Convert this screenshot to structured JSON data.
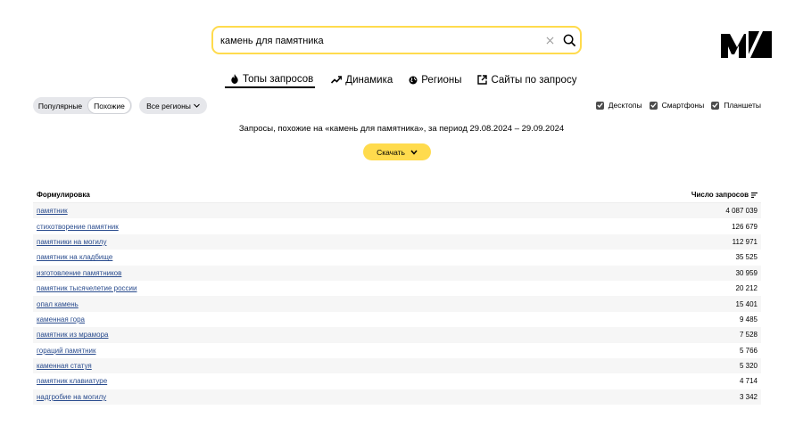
{
  "search": {
    "value": "камень для памятника",
    "clear_icon": "close-icon",
    "submit_icon": "search-icon"
  },
  "tabs": [
    {
      "label": "Топы запросов",
      "icon": "fire-icon",
      "active": true
    },
    {
      "label": "Динамика",
      "icon": "trend-icon",
      "active": false
    },
    {
      "label": "Регионы",
      "icon": "globe-icon",
      "active": false
    },
    {
      "label": "Сайты по запросу",
      "icon": "external-link-icon",
      "active": false
    }
  ],
  "filters": {
    "popular_label": "Популярные",
    "similar_label": "Похожие",
    "region_label": "Все регионы"
  },
  "devices": [
    {
      "label": "Десктопы",
      "checked": true
    },
    {
      "label": "Смартфоны",
      "checked": true
    },
    {
      "label": "Планшеты",
      "checked": true
    }
  ],
  "caption": "Запросы, похожие на «камень для памятника», за период 29.08.2024 – 29.09.2024",
  "download_label": "Скачать",
  "table": {
    "col_phrase": "Формулировка",
    "col_count": "Число запросов",
    "rows": [
      {
        "phrase": "памятник",
        "count": "4 087 039"
      },
      {
        "phrase": "стихотворение памятник",
        "count": "126 679"
      },
      {
        "phrase": "памятники на могилу",
        "count": "112 971"
      },
      {
        "phrase": "памятник на кладбище",
        "count": "35 525"
      },
      {
        "phrase": "изготовление памятников",
        "count": "30 959"
      },
      {
        "phrase": "памятник тысячелетие россии",
        "count": "20 212"
      },
      {
        "phrase": "опал камень",
        "count": "15 401"
      },
      {
        "phrase": "каменная гора",
        "count": "9 485"
      },
      {
        "phrase": "памятник из мрамора",
        "count": "7 528"
      },
      {
        "phrase": "гораций памятник",
        "count": "5 766"
      },
      {
        "phrase": "каменная статуя",
        "count": "5 320"
      },
      {
        "phrase": "памятник клавиатуре",
        "count": "4 714"
      },
      {
        "phrase": "надгробие на могилу",
        "count": "3 342"
      }
    ]
  },
  "colors": {
    "accent": "#ffdb4d",
    "link": "#2a4c8e",
    "chip": "#e6e7eb"
  }
}
